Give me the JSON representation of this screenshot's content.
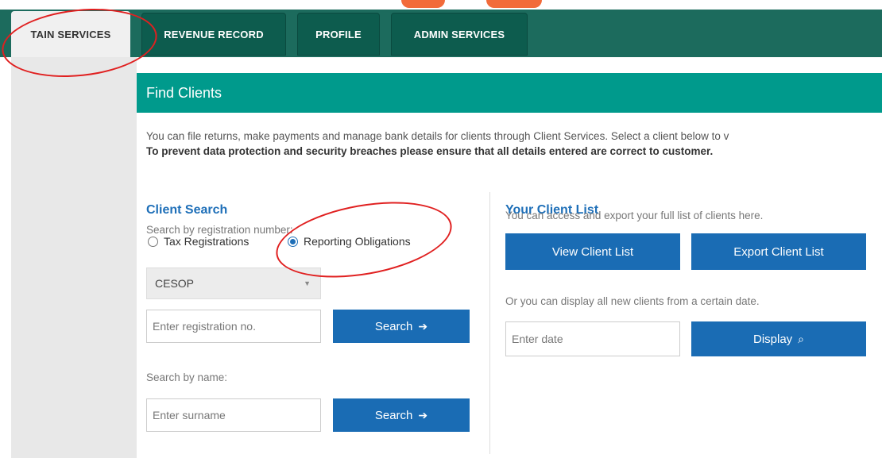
{
  "tabs": [
    {
      "label": "TAIN SERVICES",
      "active": true
    },
    {
      "label": "REVENUE RECORD",
      "active": false
    },
    {
      "label": "PROFILE",
      "active": false
    },
    {
      "label": "ADMIN SERVICES",
      "active": false
    }
  ],
  "panel": {
    "title": "Find Clients",
    "intro_line1": "You can file returns, make payments and manage bank details for clients through Client Services. Select a client below to v",
    "intro_line2": "To prevent data protection and security breaches please ensure that all details entered are correct to customer."
  },
  "client_search": {
    "title": "Client Search",
    "reg_hint": "Search by registration number:",
    "radio_tax": "Tax Registrations",
    "radio_reporting": "Reporting Obligations",
    "selected_radio": "Reporting Obligations",
    "dropdown_value": "CESOP",
    "reg_placeholder": "Enter registration no.",
    "search_label": "Search",
    "name_hint": "Search by name:",
    "surname_placeholder": "Enter surname",
    "search_label_2": "Search"
  },
  "client_list": {
    "title": "Your Client List",
    "hint": "You can access and export your full list of clients here.",
    "view_label": "View Client List",
    "export_label": "Export Client List",
    "date_hint": "Or you can display all new clients from a certain date.",
    "date_placeholder": "Enter date",
    "display_label": "Display"
  },
  "icons": {
    "arrow": "arrow-right-icon",
    "search": "search-icon",
    "caret": "caret-down-icon"
  },
  "colors": {
    "topbar": "#1c6b5d",
    "panel_header": "#009a8c",
    "button": "#1a6cb4",
    "annotation": "#e02020"
  }
}
